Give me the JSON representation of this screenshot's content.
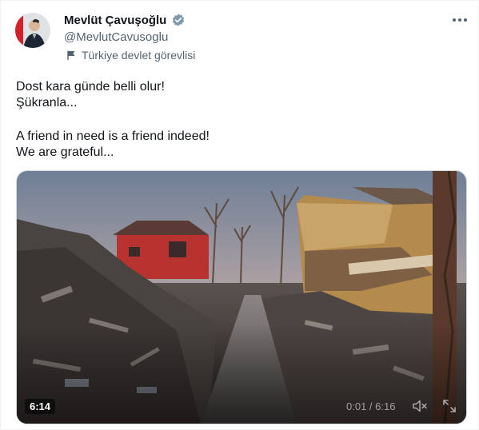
{
  "author": {
    "name": "Mevlüt Çavuşoğlu",
    "handle": "@MevlutCavusoglu",
    "label": "Türkiye devlet görevlisi",
    "verified": true
  },
  "tweet": {
    "lines": [
      "Dost kara günde belli olur!",
      "Şükranla...",
      "",
      "A friend in need is a friend indeed!",
      "We are grateful..."
    ]
  },
  "video": {
    "duration_badge": "6:14",
    "time_readout": "0:01 / 6:16"
  },
  "icons": {
    "verified": "verified-badge-icon",
    "label": "flag-icon",
    "more": "more-icon",
    "volume": "volume-muted-icon",
    "fullscreen": "fullscreen-icon"
  },
  "colors": {
    "text": "#0f1419",
    "secondary": "#536471",
    "verified_badge": "#829aab"
  }
}
